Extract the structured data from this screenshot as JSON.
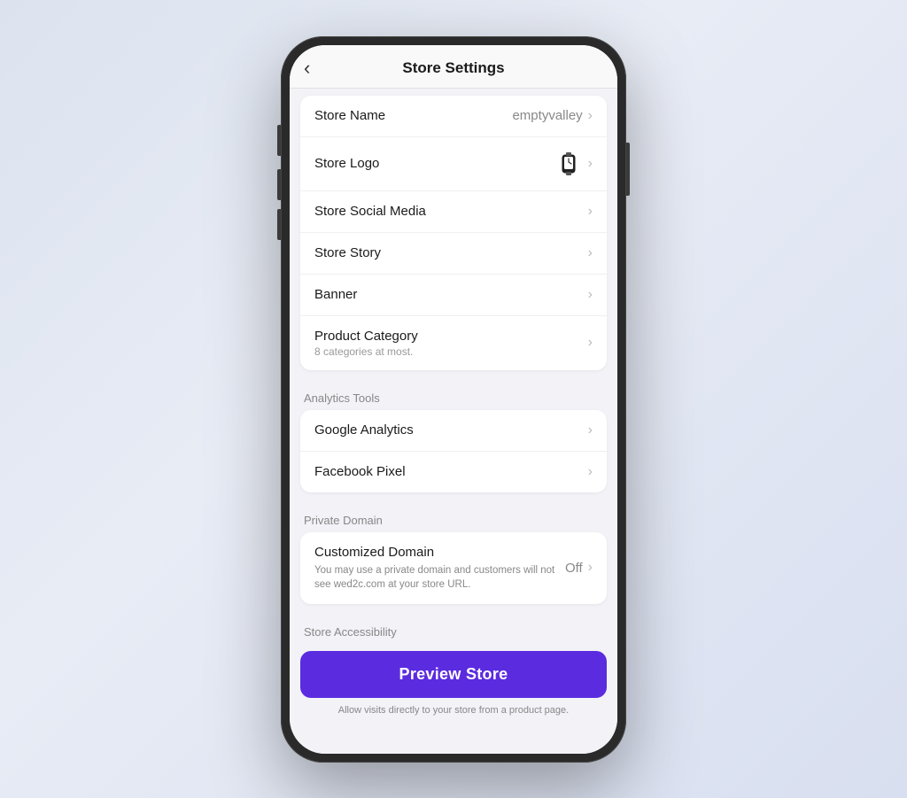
{
  "header": {
    "title": "Store Settings",
    "back_label": "‹"
  },
  "rows": [
    {
      "id": "store-name",
      "label": "Store Name",
      "value": "emptyvalley",
      "has_chevron": true,
      "group": "basic"
    },
    {
      "id": "store-logo",
      "label": "Store Logo",
      "value": "",
      "has_icon": true,
      "has_chevron": true,
      "group": "basic"
    },
    {
      "id": "store-social-media",
      "label": "Store Social Media",
      "value": "",
      "has_chevron": true,
      "group": "basic"
    },
    {
      "id": "store-story",
      "label": "Store Story",
      "value": "",
      "has_chevron": true,
      "group": "basic"
    },
    {
      "id": "banner",
      "label": "Banner",
      "value": "",
      "has_chevron": true,
      "group": "basic"
    },
    {
      "id": "product-category",
      "label": "Product Category",
      "sub": "8 categories at most.",
      "value": "",
      "has_chevron": true,
      "group": "basic"
    }
  ],
  "analytics_label": "Analytics Tools",
  "analytics_rows": [
    {
      "id": "google-analytics",
      "label": "Google Analytics",
      "has_chevron": true
    },
    {
      "id": "facebook-pixel",
      "label": "Facebook Pixel",
      "has_chevron": true
    }
  ],
  "private_domain_label": "Private Domain",
  "domain_rows": [
    {
      "id": "customized-domain",
      "label": "Customized Domain",
      "value": "Off",
      "note": "You may use a private domain and customers will not see wed2c.com at your store URL.",
      "has_chevron": true
    }
  ],
  "accessibility_label": "Store Accessibility",
  "preview_btn_label": "Preview Store",
  "accessibility_note": "Allow visits directly to your store from a product page.",
  "chevron": "›"
}
